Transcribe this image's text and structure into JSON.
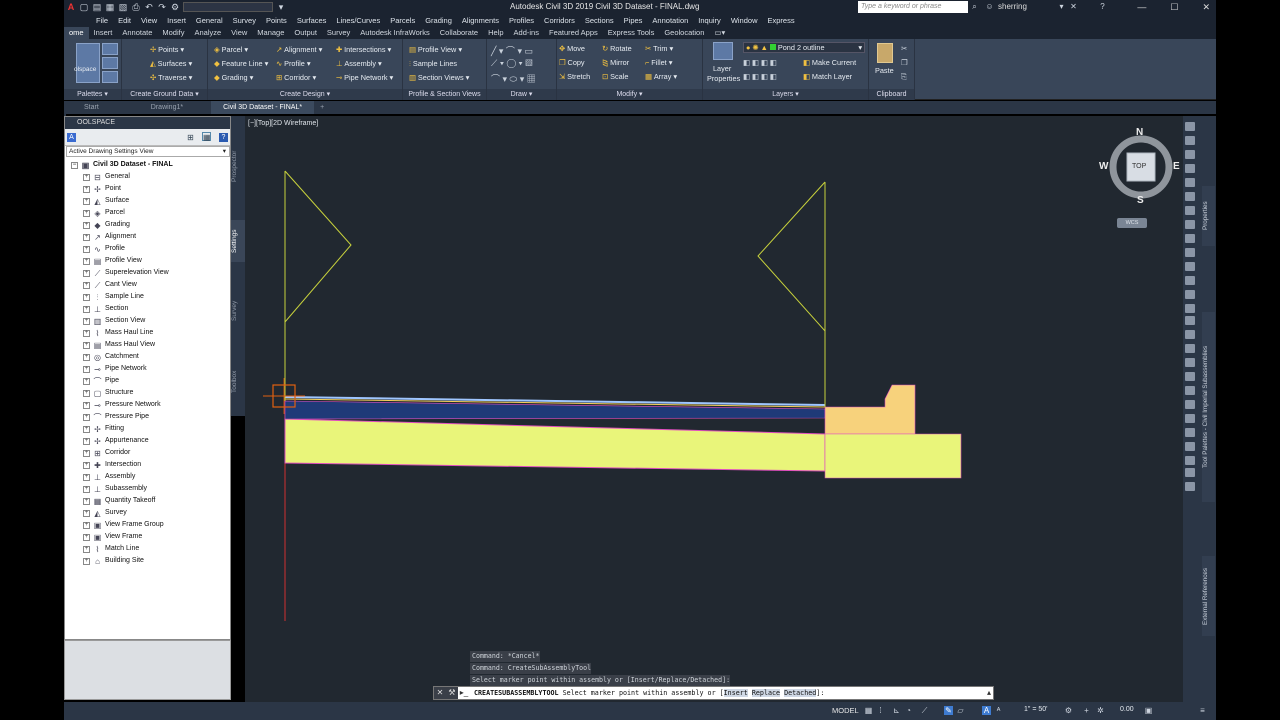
{
  "app": {
    "title": "Autodesk Civil 3D 2019    Civil 3D Dataset - FINAL.dwg",
    "search_placeholder": "Type a keyword or phrase",
    "user": "sherring"
  },
  "menubar": [
    "File",
    "Edit",
    "View",
    "Insert",
    "General",
    "Survey",
    "Points",
    "Surfaces",
    "Lines/Curves",
    "Parcels",
    "Grading",
    "Alignments",
    "Profiles",
    "Corridors",
    "Sections",
    "Pipes",
    "Annotation",
    "Inquiry",
    "Window",
    "Express"
  ],
  "ribbon_tabs": [
    "ome",
    "Insert",
    "Annotate",
    "Modify",
    "Analyze",
    "View",
    "Manage",
    "Output",
    "Survey",
    "Autodesk InfraWorks",
    "Collaborate",
    "Help",
    "Add-ins",
    "Featured Apps",
    "Express Tools",
    "Geolocation"
  ],
  "ribbon_active_tab": "ome",
  "ribbon": {
    "palettes": {
      "label": "Palettes",
      "toolspace_btn": "olspace"
    },
    "ground": {
      "label": "Create Ground Data",
      "points": "Points",
      "surfaces": "Surfaces",
      "traverse": "Traverse"
    },
    "design": {
      "label": "Create Design",
      "parcel": "Parcel",
      "feature_line": "Feature Line",
      "grading": "Grading",
      "alignment": "Alignment",
      "profile": "Profile",
      "corridor": "Corridor",
      "intersections": "Intersections",
      "assembly": "Assembly",
      "pipe_network": "Pipe Network"
    },
    "profile_section": {
      "label": "Profile & Section Views",
      "profile_view": "Profile View",
      "sample_lines": "Sample Lines",
      "section_views": "Section Views"
    },
    "draw": {
      "label": "Draw"
    },
    "modify": {
      "label": "Modify",
      "move": "Move",
      "rotate": "Rotate",
      "trim": "Trim",
      "copy": "Copy",
      "mirror": "Mirror",
      "fillet": "Fillet",
      "stretch": "Stretch",
      "scale": "Scale",
      "array": "Array"
    },
    "layers": {
      "label": "Layers",
      "layer_properties_1": "Layer",
      "layer_properties_2": "Properties",
      "current_layer": "Pond 2 outline",
      "make_current": "Make Current",
      "match_layer": "Match Layer"
    },
    "clipboard": {
      "label": "Clipboard",
      "paste": "Paste"
    }
  },
  "doc_tabs": [
    "Start",
    "Drawing1*",
    "Civil 3D Dataset - FINAL*"
  ],
  "doc_tab_add": "+",
  "toolspace": {
    "header": "OOLSPACE",
    "view_selector": "Active Drawing Settings View",
    "root": "Civil 3D Dataset - FINAL",
    "items": [
      "General",
      "Point",
      "Surface",
      "Parcel",
      "Grading",
      "Alignment",
      "Profile",
      "Profile View",
      "Superelevation View",
      "Cant View",
      "Sample Line",
      "Section",
      "Section View",
      "Mass Haul Line",
      "Mass Haul View",
      "Catchment",
      "Pipe Network",
      "Pipe",
      "Structure",
      "Pressure Network",
      "Pressure Pipe",
      "Fitting",
      "Appurtenance",
      "Corridor",
      "Intersection",
      "Assembly",
      "Subassembly",
      "Quantity Takeoff",
      "Survey",
      "View Frame Group",
      "View Frame",
      "Match Line",
      "Building Site"
    ],
    "side_tabs": [
      "Prospector",
      "Settings",
      "Survey",
      "Toolbox"
    ],
    "active_side_tab": "Settings"
  },
  "viewport": {
    "label": "[−][Top][2D Wireframe]",
    "viewcube": {
      "n": "N",
      "s": "S",
      "e": "E",
      "w": "W",
      "face": "TOP",
      "wcs": "WCS"
    }
  },
  "command": {
    "history": [
      "Command: *Cancel*",
      "Command: CreateSubAssemblyTool",
      "Select marker point within assembly or [Insert/Replace/Detached]:"
    ],
    "prompt_cmd": "CREATESUBASSEMBLYTOOL",
    "prompt_text": "Select marker point within assembly or [",
    "opt_insert": "Insert",
    "opt_replace": "Replace",
    "opt_detached": "Detached",
    "prompt_end": "]:"
  },
  "right_palette_tabs": [
    "Properties",
    "Tool Palettes - Civil Imperial Subassemblies",
    "External References"
  ],
  "statusbar": {
    "model": "MODEL",
    "scale": "1\" = 50'",
    "value": "0.00"
  },
  "colors": {
    "accent": "#394659",
    "canvas": "#212830",
    "subgrade": "#e9f57a",
    "pavement": "#1f3a78",
    "curb": "#f7d27c",
    "marker": "#e06010",
    "guide_line": "#c8d23c",
    "baseline": "#d03030"
  }
}
